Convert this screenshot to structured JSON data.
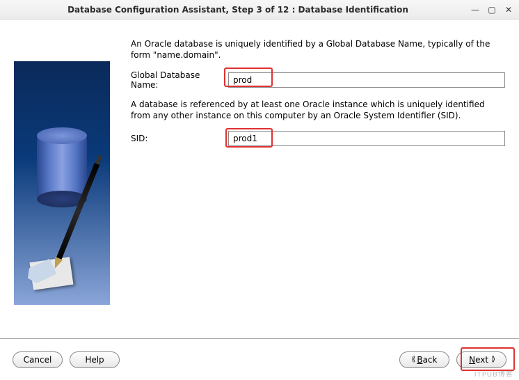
{
  "window": {
    "title": "Database Configuration Assistant, Step 3 of 12 : Database Identification"
  },
  "main": {
    "intro_text": "An Oracle database is uniquely identified by a Global Database Name, typically of the form \"name.domain\".",
    "global_db_label": "Global Database Name:",
    "global_db_value": "prod",
    "sid_intro": "A database is referenced by at least one Oracle instance which is uniquely identified from any other instance on this computer by an Oracle System Identifier (SID).",
    "sid_label": "SID:",
    "sid_value": "prod1"
  },
  "buttons": {
    "cancel": "Cancel",
    "help": "Help",
    "back_prefix": "B",
    "back_rest": "ack",
    "next_prefix": "N",
    "next_rest": "ext"
  },
  "watermark": "ITPUB博客"
}
